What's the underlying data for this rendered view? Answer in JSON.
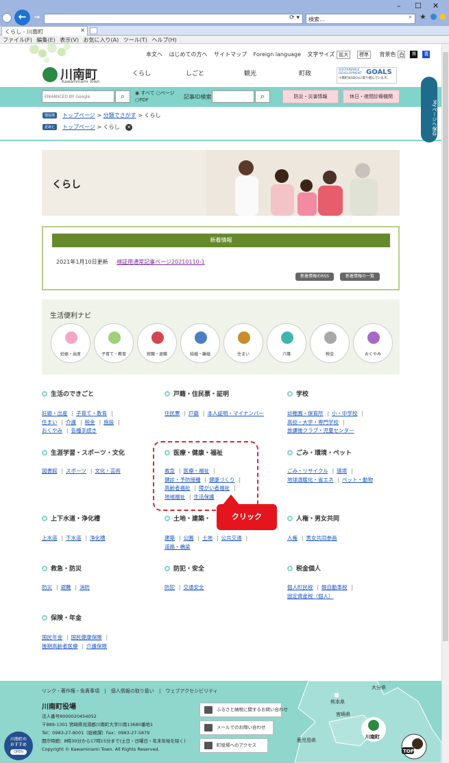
{
  "browser": {
    "search_placeholder": "検索...",
    "tab_title": "くらし - 川南町",
    "menu": [
      "ファイル(F)",
      "編集(E)",
      "表示(V)",
      "お気に入り(A)",
      "ツール(T)",
      "ヘルプ(H)"
    ]
  },
  "header": {
    "util_links": [
      "本文へ",
      "はじめての方へ",
      "サイトマップ",
      "Foreign language"
    ],
    "font_size_label": "文字サイズ",
    "font_large": "拡大",
    "font_standard": "標準",
    "bg_color_label": "背景色",
    "bg_white": "白",
    "bg_black": "黒",
    "bg_blue": "青",
    "town_name": "川南町",
    "town_name_en": "Kawaminami Town",
    "global_nav": [
      "くらし",
      "しごと",
      "観光",
      "町政"
    ],
    "sdgs_line1": "SUSTAINABLE DEVELOPMENT",
    "sdgs_goals": "GOALS",
    "sdgs_line2": "川南町はSDGsに取り組んでいます。"
  },
  "searchbar": {
    "google_placeholder": "ENHANCED BY Google",
    "radio_all": "すべて",
    "radio_page": "ページ",
    "radio_pdf": "PDF",
    "article_id_label": "記事ID検索",
    "disaster_btn": "防災・災害情報",
    "holiday_btn": "休日・夜間診療機関"
  },
  "breadcrumb": {
    "current_tag": "現在地",
    "current": [
      "トップページ",
      "分類でさがす",
      "くらし"
    ],
    "origin_tag": "足あと",
    "origin": [
      "トップページ",
      "くらし"
    ]
  },
  "hero": {
    "title": "くらし"
  },
  "news": {
    "title": "新着情報",
    "date": "2021年1月10日更新",
    "link": "検証用通常記事ページ20210110-1",
    "rss_btn": "新着情報のRSS",
    "list_btn": "新着情報の一覧"
  },
  "navi": {
    "title": "生活便利ナビ",
    "items": [
      "妊娠・出産",
      "子育て・教育",
      "就職・退職",
      "結婚・離婚",
      "住まい",
      "介護",
      "税金",
      "おくやみ"
    ]
  },
  "categories": [
    {
      "title": "生活のできごと",
      "links": [
        "妊娠・出産",
        "子育て・教育",
        "住まい",
        "介護",
        "税金",
        "施設",
        "おくやみ",
        "各種手続き"
      ]
    },
    {
      "title": "戸籍・住民票・証明",
      "links": [
        "住民票",
        "戸籍",
        "本人証明・マイナンバー"
      ]
    },
    {
      "title": "学校",
      "links": [
        "幼稚園・保育所",
        "小・中学校",
        "高校・大学・専門学校",
        "放課後クラブ・児童センター"
      ]
    },
    {
      "title": "生涯学習・スポーツ・文化",
      "links": [
        "図書館",
        "スポーツ",
        "文化・芸術"
      ]
    },
    {
      "title": "医療・健康・福祉",
      "links": [
        "救急",
        "医療・福祉",
        "健診・予防接種",
        "健康づくり",
        "高齢者福祉",
        "障がい者福祉",
        "地域福祉",
        "生活保護"
      ]
    },
    {
      "title": "ごみ・環境・ペット",
      "links": [
        "ごみ・リサイクル",
        "環境",
        "地球温暖化・省エネ",
        "ペット・動物"
      ]
    },
    {
      "title": "上下水道・浄化槽",
      "links": [
        "上水道",
        "下水道",
        "浄化槽"
      ]
    },
    {
      "title": "土地・建築・",
      "links": [
        "建築",
        "公園",
        "土地",
        "公共交通",
        "道路・橋梁"
      ]
    },
    {
      "title": "人権・男女共同",
      "links": [
        "人権",
        "男女共同参画"
      ]
    },
    {
      "title": "救急・防災",
      "links": [
        "防災",
        "避難",
        "消防"
      ]
    },
    {
      "title": "防犯・安全",
      "links": [
        "防犯",
        "交通安全"
      ]
    },
    {
      "title": "税金個人",
      "links": [
        "個人町民税",
        "軽自動車税",
        "固定資産税（個人）"
      ]
    },
    {
      "title": "保険・年金",
      "links": [
        "国民年金",
        "国民健康保険",
        "後期高齢者医療",
        "介護保険"
      ]
    }
  ],
  "callout": {
    "label": "クリック"
  },
  "footer": {
    "links": [
      "リンク・著作権・免責事項",
      "個人情報の取り扱い",
      "ウェブアクセシビリティ"
    ],
    "office": "川南町役場",
    "corp_no": "法人番号8000020454052",
    "address": "〒889-1301 宮崎県児湯郡川南町大字川南13680番地1",
    "tel": "Tel：0983-27-8001（総務課）Fax：0983-27-5879",
    "hours": "開庁時間：8時30分から17時15分まで(土日・日曜日・年末年始を除く)",
    "copyright": "Copyright © Kawaminami Town. All Rights Reserved.",
    "btn_furusato": "ふるさと納税に関するお問い合わせ",
    "btn_mail": "メールでのお問い合わせ",
    "btn_access": "町役場へのアクセス",
    "map_labels": [
      "大分県",
      "熊本県",
      "宮崎県",
      "鹿児島県"
    ],
    "map_town": "川南町",
    "osusume_line1": "川南町の",
    "osusume_line2": "おすすめ",
    "osusume_open": "OPEN",
    "top_label": "TOP"
  },
  "side": {
    "mypage": "Myページへ保存"
  },
  "colors": {
    "teal": "#82d3c9",
    "green": "#66892c",
    "red": "#e4151c",
    "link": "#1a56c4"
  }
}
